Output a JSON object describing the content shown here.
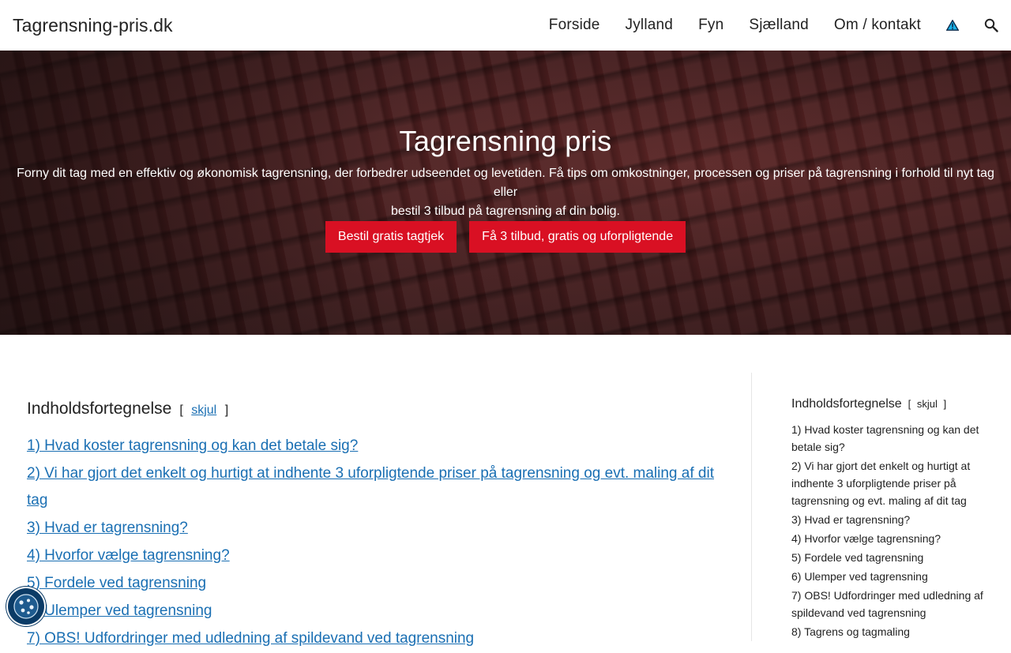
{
  "header": {
    "site_title": "Tagrensning-pris.dk",
    "nav": [
      "Forside",
      "Jylland",
      "Fyn",
      "Sjælland",
      "Om / kontakt"
    ]
  },
  "hero": {
    "title": "Tagrensning pris",
    "subtitle_line1": "Forny dit tag med en effektiv og økonomisk tagrensning, der forbedrer udseendet og levetiden. Få tips om omkostninger, processen og priser på tagrensning i forhold til nyt tag eller",
    "subtitle_line2": "bestil 3 tilbud på tagrensning af din bolig.",
    "button_primary": "Bestil gratis tagtjek",
    "button_secondary": "Få 3 tilbud, gratis og uforpligtende"
  },
  "toc": {
    "title": "Indholdsfortegnelse",
    "bracket_open": "[",
    "toggle": "skjul",
    "bracket_close": "]",
    "items": [
      "1) Hvad koster tagrensning og kan det betale sig?",
      "2) Vi har gjort det enkelt og hurtigt at indhente 3 uforpligtende priser på tagrensning og evt. maling af dit tag",
      "3) Hvad er tagrensning?",
      "4) Hvorfor vælge tagrensning?",
      "5) Fordele ved tagrensning",
      "6) Ulemper ved tagrensning",
      "7) OBS! Udfordringer med udledning af spildevand ved tagrensning"
    ]
  },
  "sidebar_toc": {
    "title": "Indholdsfortegnelse",
    "bracket_open": "[",
    "toggle": "skjul",
    "bracket_close": "]",
    "items": [
      "1) Hvad koster tagrensning og kan det betale sig?",
      "2) Vi har gjort det enkelt og hurtigt at indhente 3 uforpligtende priser på tagrensning og evt. maling af dit tag",
      "3) Hvad er tagrensning?",
      "4) Hvorfor vælge tagrensning?",
      "5) Fordele ved tagrensning",
      "6) Ulemper ved tagrensning",
      "7) OBS! Udfordringer med udledning af spildevand ved tagrensning",
      "8) Tagrens og tagmaling"
    ]
  },
  "icons": {
    "warning": "warning-icon",
    "search": "search-icon",
    "cookie": "cookie-icon"
  },
  "colors": {
    "accent": "#d91023",
    "link": "#1a6fb3",
    "cookie_bg": "#0b3b66"
  }
}
